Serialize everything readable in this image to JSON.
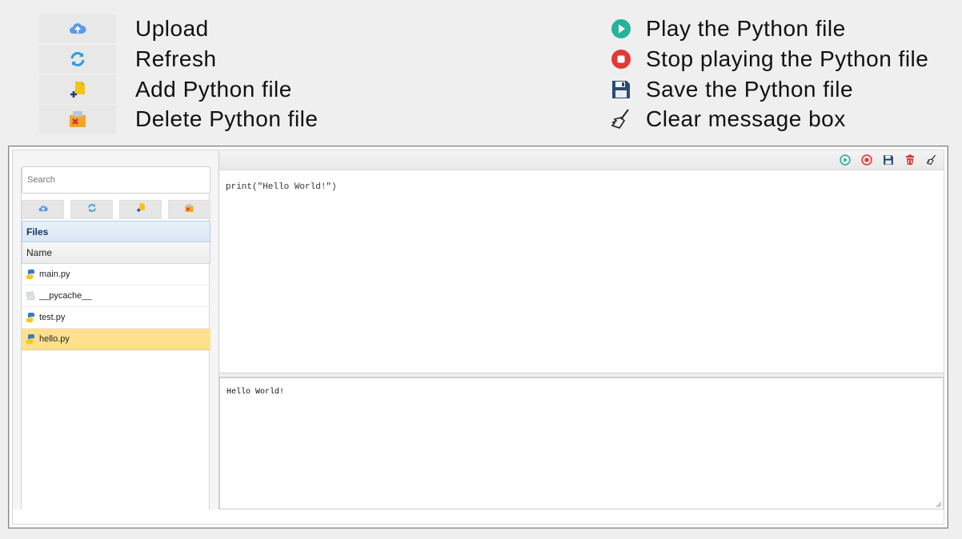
{
  "legend": {
    "left": [
      {
        "label": "Upload",
        "icon": "cloud-upload-icon"
      },
      {
        "label": "Refresh",
        "icon": "refresh-icon"
      },
      {
        "label": "Add Python file",
        "icon": "add-file-icon"
      },
      {
        "label": "Delete Python file",
        "icon": "delete-file-icon"
      }
    ],
    "right": [
      {
        "label": "Play the Python file",
        "icon": "play-icon"
      },
      {
        "label": "Stop playing the Python file",
        "icon": "stop-icon"
      },
      {
        "label": "Save the Python file",
        "icon": "save-icon"
      },
      {
        "label": "Clear message box",
        "icon": "broom-icon"
      }
    ]
  },
  "sidebar": {
    "search_placeholder": "Search",
    "files_title": "Files",
    "column_name": "Name",
    "files": [
      {
        "name": "main.py",
        "type": "python"
      },
      {
        "name": "__pycache__",
        "type": "folder"
      },
      {
        "name": "test.py",
        "type": "python"
      },
      {
        "name": "hello.py",
        "type": "python",
        "selected": true
      }
    ]
  },
  "editor": {
    "code": "print(\"Hello World!\")"
  },
  "console": {
    "output": "Hello World!"
  },
  "colors": {
    "play": "#26b39a",
    "stop": "#e53935",
    "save": "#2b4a6f",
    "delete": "#d32f2f",
    "selected_row": "#ffe08e",
    "upload_blue": "#4a8fe0"
  }
}
